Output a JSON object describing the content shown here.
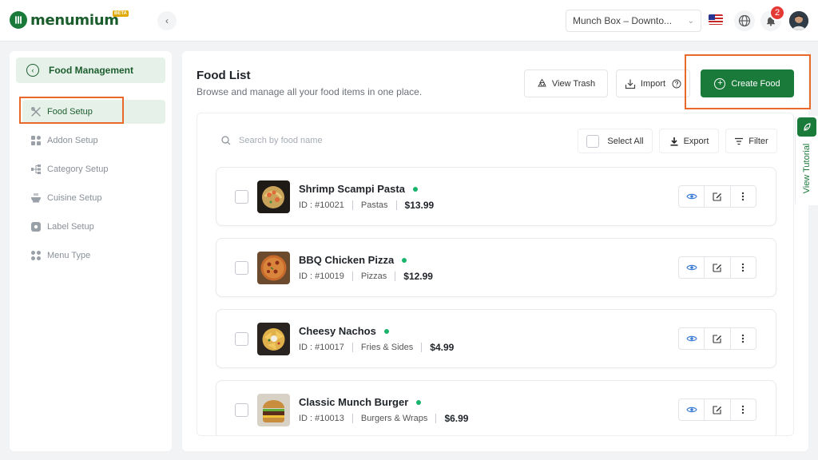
{
  "brand": {
    "name": "menumium",
    "badge": "BETA",
    "color": "#1a7a3a"
  },
  "header": {
    "branch": "Munch Box – Downto...",
    "notification_count": "2"
  },
  "sidebar": {
    "section_title": "Food Management",
    "items": [
      {
        "label": "Food Setup",
        "icon": "utensils-icon",
        "active": true
      },
      {
        "label": "Addon Setup",
        "icon": "addon-icon"
      },
      {
        "label": "Category Setup",
        "icon": "category-tree-icon"
      },
      {
        "label": "Cuisine Setup",
        "icon": "cuisine-icon"
      },
      {
        "label": "Label Setup",
        "icon": "label-icon"
      },
      {
        "label": "Menu Type",
        "icon": "grid-icon"
      }
    ]
  },
  "main": {
    "title": "Food List",
    "subtitle": "Browse and manage all your food items in one place.",
    "view_trash_label": "View Trash",
    "import_label": "Import",
    "create_label": "Create Food",
    "search_placeholder": "Search by food name",
    "select_all_label": "Select All",
    "export_label": "Export",
    "filter_label": "Filter"
  },
  "foods": [
    {
      "name": "Shrimp Scampi Pasta",
      "id": "ID : #10021",
      "category": "Pastas",
      "price": "$13.99"
    },
    {
      "name": "BBQ Chicken Pizza",
      "id": "ID : #10019",
      "category": "Pizzas",
      "price": "$12.99"
    },
    {
      "name": "Cheesy Nachos",
      "id": "ID : #10017",
      "category": "Fries & Sides",
      "price": "$4.99"
    },
    {
      "name": "Classic Munch Burger",
      "id": "ID : #10013",
      "category": "Burgers & Wraps",
      "price": "$6.99"
    }
  ],
  "tutorial": {
    "label": "View Tutorial"
  },
  "colors": {
    "accent": "#1a7a3a",
    "highlight": "#e8692a",
    "status_active": "#19b36b",
    "badge": "#e53935"
  }
}
